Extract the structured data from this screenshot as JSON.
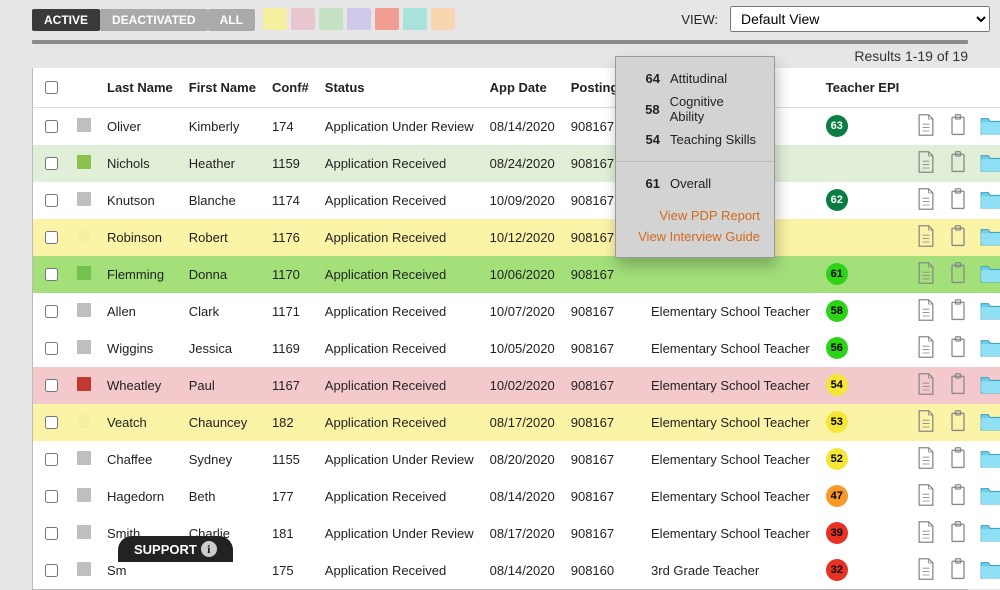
{
  "toolbar": {
    "pills": [
      "ACTIVE",
      "DEACTIVATED",
      "ALL"
    ],
    "active_index": 0,
    "swatches": [
      "#f6f09f",
      "#e8c6cf",
      "#c5e2c4",
      "#d0c9ea",
      "#f09e91",
      "#a8e2db",
      "#f8d7b0"
    ],
    "view_label": "VIEW:",
    "view_value": "Default View"
  },
  "results_text": "Results 1-19 of 19",
  "columns": {
    "last": "Last Name",
    "first": "First Name",
    "conf": "Conf#",
    "status": "Status",
    "date": "App Date",
    "posting": "Posting ID",
    "title": "",
    "epi": "Teacher EPI"
  },
  "rows": [
    {
      "color": "#bfbfbf",
      "bg": "#ffffff",
      "last": "Oliver",
      "first": "Kimberly",
      "conf": "174",
      "status": "Application Under Review",
      "date": "08/14/2020",
      "posting": "908167",
      "title": "",
      "epi": "63",
      "epiBg": "#0a7d42",
      "epiFg": "#ffffff"
    },
    {
      "color": "#8bc24a",
      "bg": "#e2efd8",
      "last": "Nichols",
      "first": "Heather",
      "conf": "1159",
      "status": "Application Received",
      "date": "08/24/2020",
      "posting": "908167",
      "title": "",
      "epi": "",
      "epiBg": "",
      "epiFg": ""
    },
    {
      "color": "#bfbfbf",
      "bg": "#ffffff",
      "last": "Knutson",
      "first": "Blanche",
      "conf": "1174",
      "status": "Application Received",
      "date": "10/09/2020",
      "posting": "908167",
      "title": "",
      "epi": "62",
      "epiBg": "#0a7d42",
      "epiFg": "#ffffff"
    },
    {
      "color": "#f6f09f",
      "bg": "#fbf3a6",
      "last": "Robinson",
      "first": "Robert",
      "conf": "1176",
      "status": "Application Received",
      "date": "10/12/2020",
      "posting": "908167",
      "title": "",
      "epi": "",
      "epiBg": "",
      "epiFg": ""
    },
    {
      "color": "#73c24b",
      "bg": "#a3e07a",
      "last": "Flemming",
      "first": "Donna",
      "conf": "1170",
      "status": "Application Received",
      "date": "10/06/2020",
      "posting": "908167",
      "title": "",
      "epi": "61",
      "epiBg": "#2dd317",
      "epiFg": "#000000"
    },
    {
      "color": "#bfbfbf",
      "bg": "#ffffff",
      "last": "Allen",
      "first": "Clark",
      "conf": "1171",
      "status": "Application Received",
      "date": "10/07/2020",
      "posting": "908167",
      "title": "Elementary School Teacher",
      "epi": "58",
      "epiBg": "#2dd317",
      "epiFg": "#000000"
    },
    {
      "color": "#bfbfbf",
      "bg": "#ffffff",
      "last": "Wiggins",
      "first": "Jessica",
      "conf": "1169",
      "status": "Application Received",
      "date": "10/05/2020",
      "posting": "908167",
      "title": "Elementary School Teacher",
      "epi": "56",
      "epiBg": "#2dd317",
      "epiFg": "#000000"
    },
    {
      "color": "#c0392b",
      "bg": "#f4c9cc",
      "last": "Wheatley",
      "first": "Paul",
      "conf": "1167",
      "status": "Application Received",
      "date": "10/02/2020",
      "posting": "908167",
      "title": "Elementary School Teacher",
      "epi": "54",
      "epiBg": "#f5e637",
      "epiFg": "#000000"
    },
    {
      "color": "#f6f09f",
      "bg": "#fbf3a6",
      "last": "Veatch",
      "first": "Chauncey",
      "conf": "182",
      "status": "Application Received",
      "date": "08/17/2020",
      "posting": "908167",
      "title": "Elementary School Teacher",
      "epi": "53",
      "epiBg": "#f5e637",
      "epiFg": "#000000"
    },
    {
      "color": "#bfbfbf",
      "bg": "#ffffff",
      "last": "Chaffee",
      "first": "Sydney",
      "conf": "1155",
      "status": "Application Under Review",
      "date": "08/20/2020",
      "posting": "908167",
      "title": "Elementary School Teacher",
      "epi": "52",
      "epiBg": "#f5e637",
      "epiFg": "#000000"
    },
    {
      "color": "#bfbfbf",
      "bg": "#ffffff",
      "last": "Hagedorn",
      "first": "Beth",
      "conf": "177",
      "status": "Application Received",
      "date": "08/14/2020",
      "posting": "908167",
      "title": "Elementary School Teacher",
      "epi": "47",
      "epiBg": "#f79a29",
      "epiFg": "#000000"
    },
    {
      "color": "#bfbfbf",
      "bg": "#ffffff",
      "last": "Smith",
      "first": "Charlie",
      "conf": "181",
      "status": "Application Under Review",
      "date": "08/17/2020",
      "posting": "908167",
      "title": "Elementary School Teacher",
      "epi": "39",
      "epiBg": "#e63224",
      "epiFg": "#000000"
    },
    {
      "color": "#bfbfbf",
      "bg": "#ffffff",
      "last": "Sm",
      "first": "",
      "conf": "175",
      "status": "Application Received",
      "date": "08/14/2020",
      "posting": "908160",
      "title": "3rd Grade Teacher",
      "epi": "32",
      "epiBg": "#e63224",
      "epiFg": "#000000"
    }
  ],
  "popover": {
    "scores": [
      {
        "num": "64",
        "label": "Attitudinal"
      },
      {
        "num": "58",
        "label": "Cognitive Ability"
      },
      {
        "num": "54",
        "label": "Teaching Skills"
      }
    ],
    "overall_num": "61",
    "overall_label": "Overall",
    "link1": "View PDP Report",
    "link2": "View Interview Guide"
  },
  "support": "SUPPORT"
}
